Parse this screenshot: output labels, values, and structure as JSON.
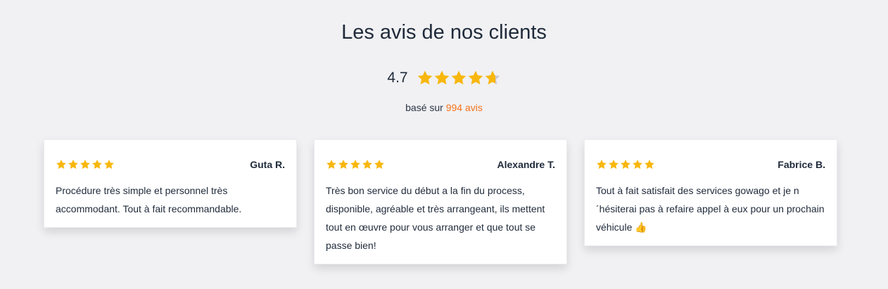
{
  "header": {
    "title": "Les avis de nos clients"
  },
  "summary": {
    "score": "4.7",
    "rating": 4.7,
    "based_prefix": "basé sur",
    "based_link": "994 avis"
  },
  "colors": {
    "star": "#f8b70e",
    "star_empty": "#c9c9d3",
    "accent": "#f5731c"
  },
  "reviews": [
    {
      "author": "Guta R.",
      "stars": 5,
      "text": "Procédure très simple et personnel très accommodant. Tout à fait recommandable."
    },
    {
      "author": "Alexandre T.",
      "stars": 5,
      "text": "Très bon service du début a la fin du process, disponible, agréable et très arrangeant, ils mettent tout en œuvre pour vous arranger et que tout se passe bien!"
    },
    {
      "author": "Fabrice B.",
      "stars": 5,
      "text": "Tout à fait satisfait des services gowago et je n ´hésiterai pas à refaire appel à eux pour un prochain véhicule 👍"
    }
  ]
}
